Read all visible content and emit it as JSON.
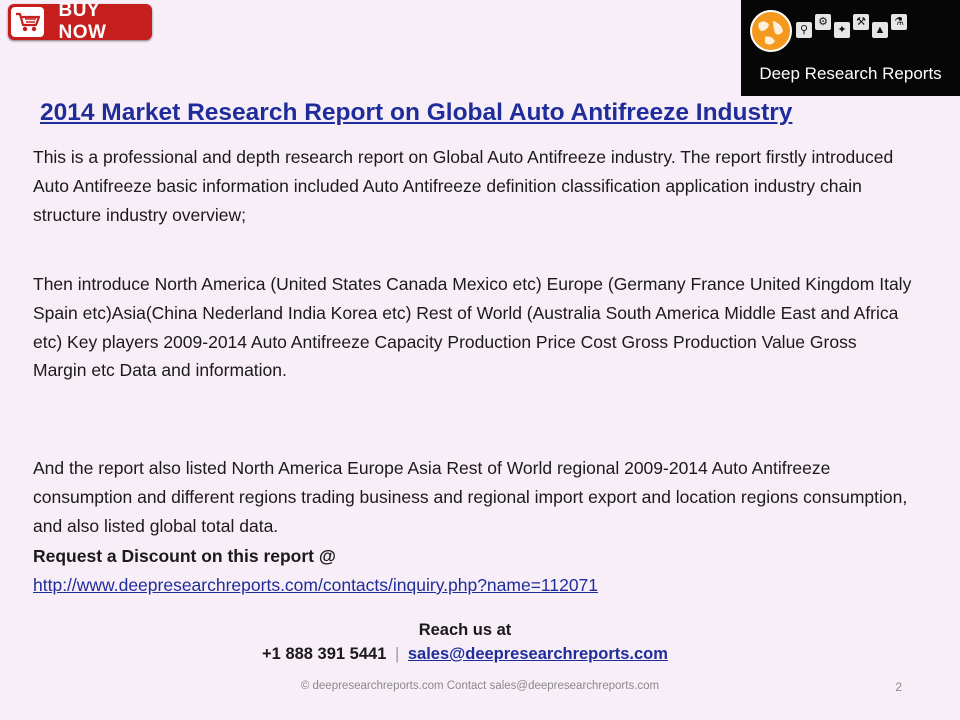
{
  "buy_button": {
    "label": "BUY NOW",
    "icon": "shopping-cart-icon",
    "color": "#c61d1d"
  },
  "logo": {
    "name": "Deep Research Reports",
    "icons": [
      "globe-icon",
      "search-icon",
      "settings-icon",
      "puzzle-icon",
      "wrench-icon",
      "flask-icon"
    ]
  },
  "title": "2014 Market Research Report on Global Auto Antifreeze Industry",
  "paragraphs": [
    " This is a professional and depth research report on Global Auto Antifreeze industry. The report firstly introduced Auto Antifreeze basic information included Auto Antifreeze definition classification application industry chain structure industry overview;",
    "Then introduce North America (United States Canada Mexico etc) Europe (Germany France United Kingdom Italy Spain etc)Asia(China Nederland India Korea etc) Rest of World (Australia South America Middle East and Africa etc) Key players 2009-2014 Auto Antifreeze Capacity Production Price Cost Gross Production Value Gross Margin etc Data and information.",
    "And the report also listed North America Europe Asia Rest of World regional 2009-2014 Auto Antifreeze consumption and different regions trading business and regional import export and location regions consumption, and also listed global total data."
  ],
  "request": {
    "text": "Request a Discount on this report @",
    "link": "http://www.deepresearchreports.com/contacts/inquiry.php?name=112071"
  },
  "contact": {
    "heading": "Reach us at",
    "phone": "+1 888 391 5441",
    "separator": "|",
    "email": "sales@deepresearchreports.com"
  },
  "footer": {
    "text": "© deepresearchreports.com Contact sales@deepresearchreports.com",
    "page_number": "2"
  }
}
